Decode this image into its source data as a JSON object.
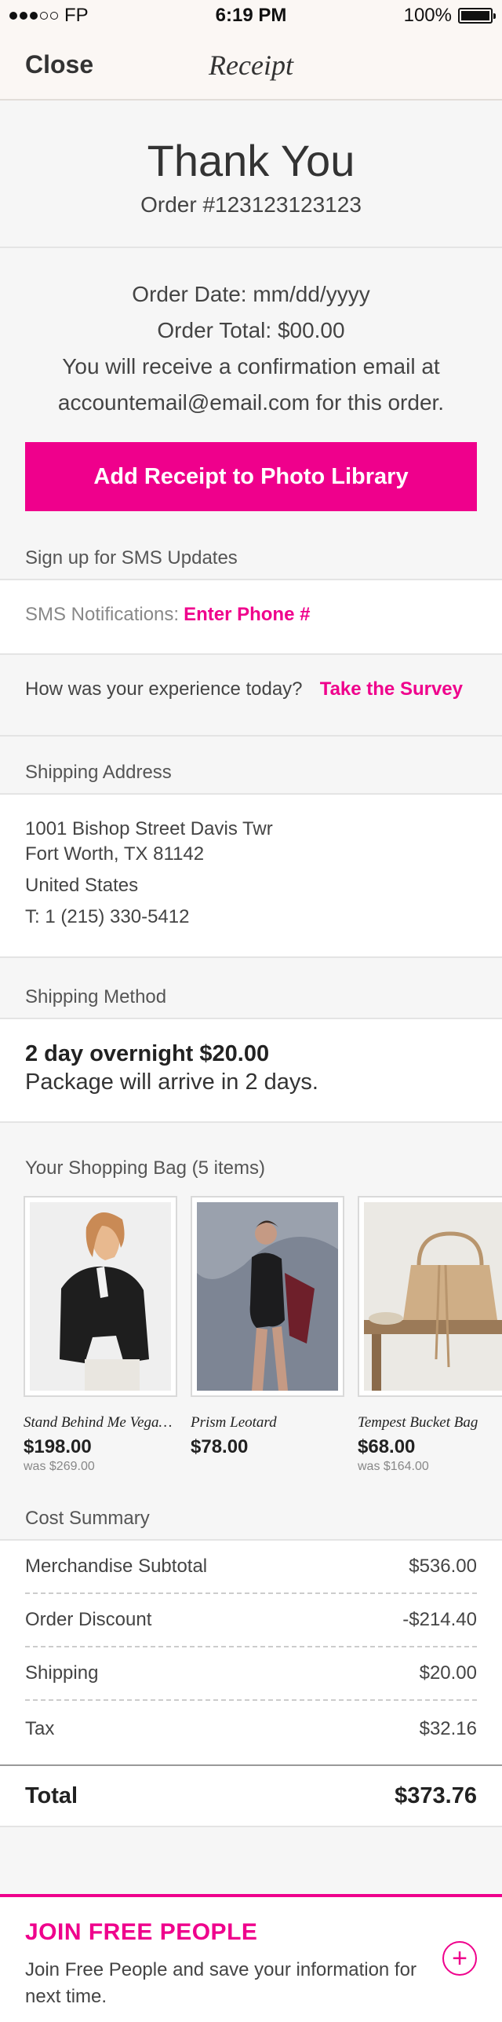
{
  "status_bar": {
    "carrier": "FP",
    "time": "6:19 PM",
    "battery": "100%",
    "battery_level": 1.0
  },
  "nav": {
    "close_label": "Close",
    "title": "Receipt"
  },
  "thanks": {
    "title": "Thank You",
    "order_number": "Order #123123123123"
  },
  "order_info": {
    "date": "Order Date: mm/dd/yyyy",
    "total": "Order Total: $00.00",
    "email_line1": "You will receive a confirmation email at",
    "email_line2": "accountemail@email.com for this order."
  },
  "receipt_button": "Add Receipt to Photo Library",
  "sms": {
    "header": "Sign up for SMS Updates",
    "label": "SMS Notifications:",
    "link": "Enter Phone #"
  },
  "survey": {
    "question": "How was your experience today?",
    "link": "Take the Survey"
  },
  "shipping_address": {
    "header": "Shipping Address",
    "line1": "1001 Bishop Street Davis Twr",
    "line2": "Fort Worth, TX 81142",
    "country": "United States",
    "phone": "T: 1 (215) 330-5412"
  },
  "shipping_method": {
    "header": "Shipping Method",
    "main": "2 day overnight $20.00",
    "sub": "Package will arrive in 2 days."
  },
  "bag": {
    "header": "Your Shopping Bag (5 items)",
    "items": [
      {
        "name": "Stand Behind Me Vegan...",
        "price": "$198.00",
        "was": "was $269.00"
      },
      {
        "name": "Prism Leotard",
        "price": "$78.00",
        "was": ""
      },
      {
        "name": "Tempest Bucket Bag",
        "price": "$68.00",
        "was": "was $164.00"
      }
    ]
  },
  "cost_summary": {
    "header": "Cost Summary",
    "rows": [
      {
        "label": "Merchandise Subtotal",
        "value": "$536.00"
      },
      {
        "label": "Order Discount",
        "value": "-$214.40"
      },
      {
        "label": "Shipping",
        "value": "$20.00"
      },
      {
        "label": "Tax",
        "value": "$32.16"
      }
    ],
    "total_label": "Total",
    "total_value": "$373.76"
  },
  "join": {
    "title": "JOIN FREE PEOPLE",
    "text": "Join Free People and save your information for next time.",
    "icon": "plus-circle-icon"
  },
  "colors": {
    "accent": "#ef008c",
    "header_bg": "#fbf7f4",
    "page_bg": "#f6f6f6"
  }
}
